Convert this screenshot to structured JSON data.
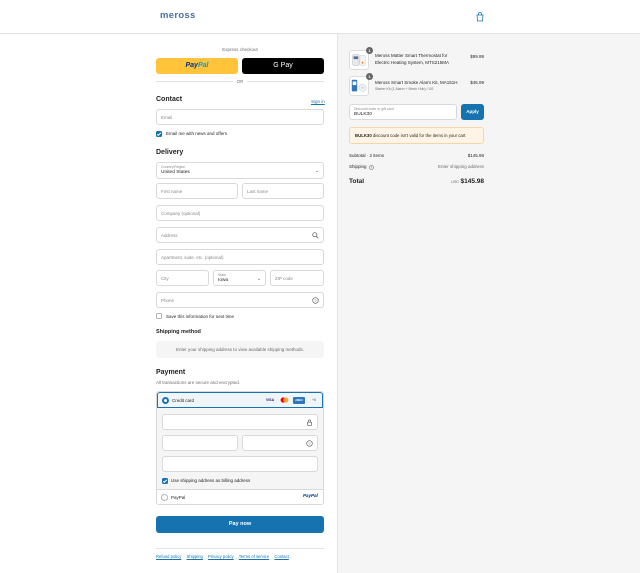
{
  "header": {
    "brand": "meross"
  },
  "express": {
    "label": "Express checkout",
    "paypal_a": "Pay",
    "paypal_b": "Pal",
    "gpay": "G Pay",
    "or": "OR"
  },
  "contact": {
    "title": "Contact",
    "sign_in": "Sign in",
    "email_placeholder": "Email",
    "news_label": "Email me with news and offers"
  },
  "delivery": {
    "title": "Delivery",
    "country_label": "Country/Region",
    "country_value": "United States",
    "first_name": "First name",
    "last_name": "Last name",
    "company": "Company (optional)",
    "address": "Address",
    "apartment": "Apartment, suite, etc. (optional)",
    "city": "City",
    "state_label": "State",
    "state_value": "Iowa",
    "zip": "ZIP code",
    "phone": "Phone",
    "save_label": "Save this information for next time"
  },
  "shipping_method": {
    "title": "Shipping method",
    "message": "Enter your shipping address to view available shipping methods."
  },
  "payment": {
    "title": "Payment",
    "subtitle": "All transactions are secure and encrypted.",
    "credit_card": "Credit card",
    "brands": [
      "VISA",
      "MC",
      "AMEX",
      "+5"
    ],
    "billing_label": "Use shipping address as billing address",
    "paypal": "PayPal",
    "paypal_logo": "PayPal"
  },
  "pay_button": "Pay now",
  "footer": [
    "Refund policy",
    "Shipping",
    "Privacy policy",
    "Terms of service",
    "Contact"
  ],
  "cart": {
    "items": [
      {
        "qty": "1",
        "name": "Meross Matter Smart Thermostat for Electric Heating System, MTS215MA",
        "variant": "",
        "price": "$99.99"
      },
      {
        "qty": "1",
        "name": "Meross Smart Smoke Alarm Kit, MA151H",
        "variant": "Starter Kit (1 Alarm + Mesh Hub) / US",
        "price": "$45.99"
      }
    ],
    "discount_label": "Discount code or gift card",
    "discount_value": "BULK30",
    "apply": "Apply",
    "warning_code": "BULK30",
    "warning_text": " discount code isn't valid for the items in your cart",
    "subtotal_label": "Subtotal · 2 items",
    "subtotal_value": "$145.98",
    "shipping_label": "Shipping",
    "shipping_value": "Enter shipping address",
    "total_label": "Total",
    "currency": "USD",
    "total_value": "$145.98"
  },
  "colors": {
    "accent": "#1773b0",
    "paypal": "#ffc439",
    "brand": "#4a6fa5"
  }
}
